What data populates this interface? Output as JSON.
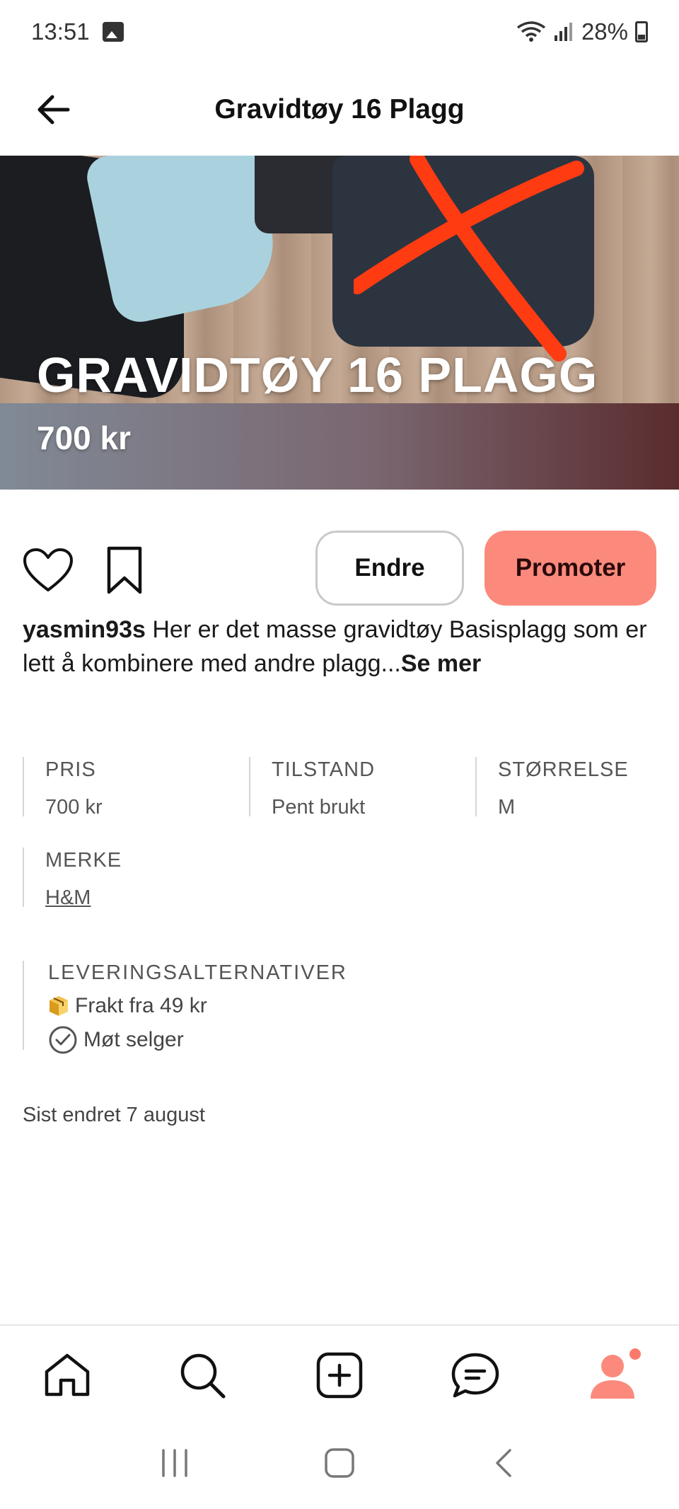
{
  "status_bar": {
    "time": "13:51",
    "battery": "28%"
  },
  "header": {
    "title": "Gravidtøy 16 Plagg"
  },
  "hero": {
    "title": "GRAVIDTØY 16 PLAGG",
    "price": "700 kr"
  },
  "actions": {
    "edit_label": "Endre",
    "promote_label": "Promoter"
  },
  "description": {
    "username": "yasmin93s",
    "text": "Her er det masse gravidtøy Basisplagg som er lett å kombinere med andre plagg...",
    "more": "Se mer"
  },
  "attributes": [
    {
      "label": "PRIS",
      "value": "700 kr"
    },
    {
      "label": "TILSTAND",
      "value": "Pent brukt"
    },
    {
      "label": "STØRRELSE",
      "value": "M"
    },
    {
      "label": "MERKE",
      "value": "H&M"
    }
  ],
  "delivery": {
    "title": "LEVERINGSALTERNATIVER",
    "options": [
      {
        "icon": "package-icon",
        "label": "Frakt fra 49 kr"
      },
      {
        "icon": "check-circle-icon",
        "label": "Møt selger"
      }
    ]
  },
  "updated": "Sist endret 7 august",
  "bottom_nav": [
    "home-icon",
    "search-icon",
    "add-icon",
    "messages-icon",
    "profile-icon"
  ],
  "colors": {
    "accent": "#fb8a7d",
    "cross": "#ff3b12"
  }
}
